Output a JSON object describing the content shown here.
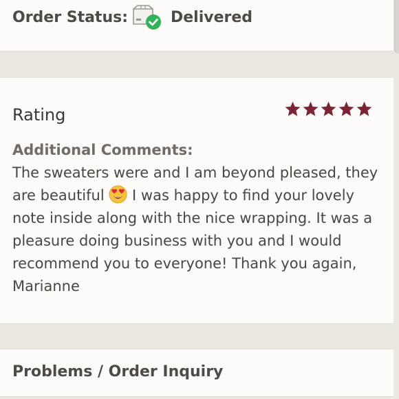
{
  "order_status": {
    "label": "Order Status:",
    "icon": "package-delivered-icon",
    "value": "Delivered",
    "check_color": "#2fb45a"
  },
  "rating": {
    "title": "Rating",
    "stars": 5,
    "max_stars": 5,
    "star_color": "#7b2433"
  },
  "comments": {
    "label": "Additional Comments:",
    "text_before_emoji": "The sweaters were and I am beyond pleased, they are beautiful ",
    "emoji": "heart-eyes-emoji",
    "text_after_emoji": " I was happy to find your lovely note inside along with the nice wrapping. It was a pleasure doing business with you and I would recommend you to everyone! Thank you again, Marianne"
  },
  "problems": {
    "label": "Problems / Order Inquiry"
  }
}
